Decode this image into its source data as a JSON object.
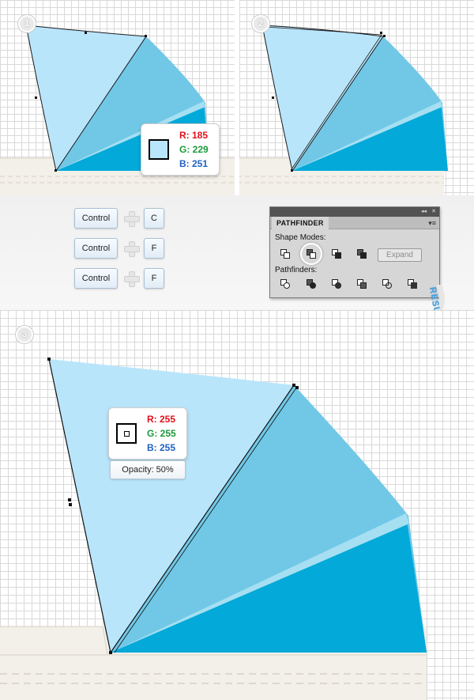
{
  "steps": {
    "one": "1",
    "two": "2",
    "three": "3"
  },
  "color_fill": {
    "swatch_color": "#b9e5fb",
    "r": "R: 185",
    "g": "G: 229",
    "b": "B: 251"
  },
  "color_white": {
    "swatch_color": "#ffffff",
    "r": "R: 255",
    "g": "G: 255",
    "b": "B: 255",
    "opacity": "Opacity: 50%"
  },
  "shortcuts": [
    {
      "modifier": "Control",
      "key": "C"
    },
    {
      "modifier": "Control",
      "key": "F"
    },
    {
      "modifier": "Control",
      "key": "F"
    }
  ],
  "pathfinder": {
    "title": "PATHFINDER",
    "shape_modes_label": "Shape Modes:",
    "pathfinders_label": "Pathfinders:",
    "expand_label": "Expand",
    "collapse_glyph": "◂◂",
    "close_glyph": "✕",
    "menu_glyph": "▾≡"
  },
  "result_label": "RESULT",
  "colors": {
    "light_blue": "#b9e5fb",
    "mid_blue": "#71c8e6",
    "dark_blue": "#02a9d9",
    "fabric": "#f3f0e9",
    "stitch": "#d6d0c3"
  }
}
